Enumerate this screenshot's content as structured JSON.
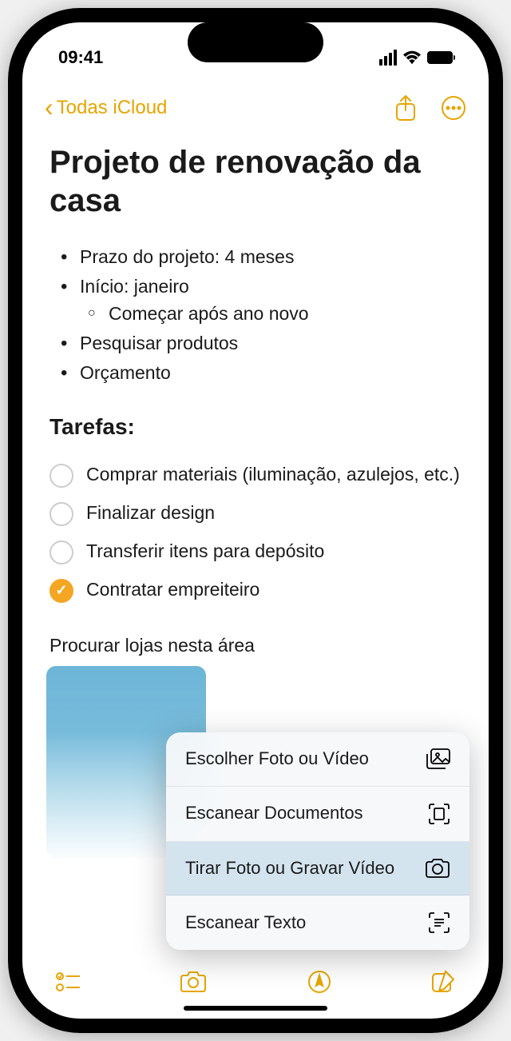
{
  "statusBar": {
    "time": "09:41"
  },
  "nav": {
    "backLabel": "Todas iCloud"
  },
  "note": {
    "title": "Projeto de renovação da casa",
    "bullets": {
      "b1": "Prazo do projeto: 4 meses",
      "b2": "Início: janeiro",
      "b2_sub": "Começar após ano novo",
      "b3": "Pesquisar produtos",
      "b4": "Orçamento"
    },
    "tasksHeading": "Tarefas:",
    "tasks": {
      "t1": "Comprar materiais (iluminação, azulejos, etc.)",
      "t2": "Finalizar design",
      "t3": "Transferir itens para depósito",
      "t4": "Contratar empreiteiro"
    },
    "searchArea": "Procurar lojas nesta área"
  },
  "menu": {
    "choosePhoto": "Escolher Foto ou Vídeo",
    "scanDocs": "Escanear Documentos",
    "takePhoto": "Tirar Foto ou Gravar Vídeo",
    "scanText": "Escanear Texto"
  }
}
